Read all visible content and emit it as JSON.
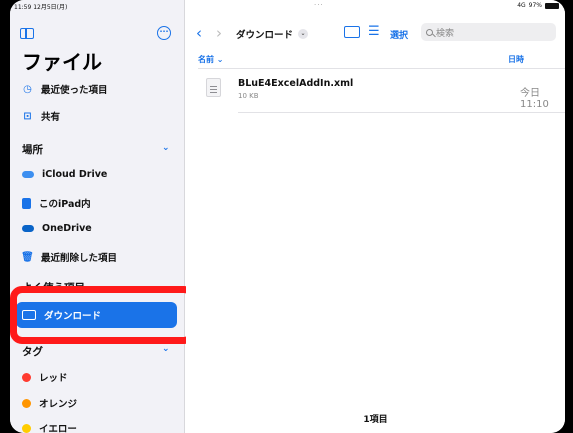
{
  "status": {
    "time": "11:59",
    "date": "12月5日(月)",
    "signal": "4G",
    "battery": "97%"
  },
  "sidebar": {
    "title": "ファイル",
    "recent": "最近使った項目",
    "shared": "共有",
    "locations_header": "場所",
    "locations": [
      "iCloud Drive",
      "このiPad内",
      "OneDrive",
      "最近削除した項目"
    ],
    "favorites_header": "よく使う項目",
    "favorites": [
      "ダウンロード"
    ],
    "tags_header": "タグ",
    "tags": [
      {
        "label": "レッド",
        "color": "#ff3b30"
      },
      {
        "label": "オレンジ",
        "color": "#ff9500"
      },
      {
        "label": "イエロー",
        "color": "#ffcc00"
      }
    ]
  },
  "toolbar": {
    "title": "ダウンロード",
    "select": "選択",
    "search_placeholder": "検索"
  },
  "columns": {
    "name": "名前",
    "date": "日時"
  },
  "files": [
    {
      "name": "BLuE4ExcelAddIn.xml",
      "size": "10 KB",
      "date": "今日 11:10"
    }
  ],
  "footer": {
    "count": "1項目"
  },
  "colors": {
    "accent": "#1a73e8",
    "highlight": "#ff1a1a"
  }
}
